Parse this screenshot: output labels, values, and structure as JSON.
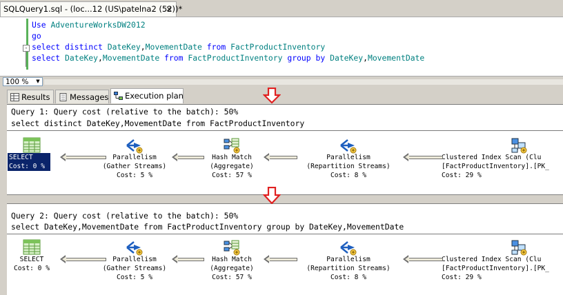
{
  "window": {
    "tab_title": "SQLQuery1.sql - (loc...12 (US\\patelna2 (52))*",
    "close_glyph": "×"
  },
  "editor": {
    "lines": [
      {
        "parts": [
          {
            "t": "Use ",
            "c": "kw"
          },
          {
            "t": "AdventureWorksDW2012",
            "c": "tx"
          }
        ]
      },
      {
        "parts": [
          {
            "t": "go",
            "c": "kw"
          }
        ]
      },
      {
        "parts": [
          {
            "t": "select distinct ",
            "c": "kw"
          },
          {
            "t": "DateKey",
            "c": "tx"
          },
          {
            "t": ",",
            "c": "pl"
          },
          {
            "t": "MovementDate ",
            "c": "tx"
          },
          {
            "t": "from ",
            "c": "kw"
          },
          {
            "t": "FactProductInventory",
            "c": "tx"
          }
        ]
      },
      {
        "parts": [
          {
            "t": "select ",
            "c": "kw"
          },
          {
            "t": "DateKey",
            "c": "tx"
          },
          {
            "t": ",",
            "c": "pl"
          },
          {
            "t": "MovementDate ",
            "c": "tx"
          },
          {
            "t": "from ",
            "c": "kw"
          },
          {
            "t": "FactProductInventory ",
            "c": "tx"
          },
          {
            "t": "group by ",
            "c": "kw"
          },
          {
            "t": "DateKey",
            "c": "tx"
          },
          {
            "t": ",",
            "c": "pl"
          },
          {
            "t": "MovementDate",
            "c": "tx"
          }
        ]
      }
    ],
    "outline_glyph": "-"
  },
  "zoom": {
    "value": "100 %",
    "dropdown_glyph": "▼"
  },
  "results_tabs": [
    {
      "label": "Results"
    },
    {
      "label": "Messages"
    },
    {
      "label": "Execution plan"
    }
  ],
  "queries": [
    {
      "header": "Query 1: Query cost (relative to the batch): 50%",
      "sql": "select distinct DateKey,MovementDate from FactProductInventory",
      "nodes": [
        {
          "name": "SELECT",
          "sub": "",
          "cost": "Cost: 0 %",
          "selected": true,
          "icon": "select-icon"
        },
        {
          "name": "Parallelism",
          "sub": "(Gather Streams)",
          "cost": "Cost: 5 %",
          "icon": "parallelism-icon"
        },
        {
          "name": "Hash Match",
          "sub": "(Aggregate)",
          "cost": "Cost: 57 %",
          "icon": "hash-match-icon"
        },
        {
          "name": "Parallelism",
          "sub": "(Repartition Streams)",
          "cost": "Cost: 8 %",
          "icon": "parallelism-icon"
        },
        {
          "name": "Clustered Index Scan (Clu",
          "sub": "[FactProductInventory].[PK_",
          "cost": "Cost: 29 %",
          "icon": "clustered-index-scan-icon"
        }
      ]
    },
    {
      "header": "Query 2: Query cost (relative to the batch): 50%",
      "sql": "select DateKey,MovementDate from FactProductInventory group by DateKey,MovementDate",
      "nodes": [
        {
          "name": "SELECT",
          "sub": "",
          "cost": "Cost: 0 %",
          "selected": false,
          "icon": "select-icon"
        },
        {
          "name": "Parallelism",
          "sub": "(Gather Streams)",
          "cost": "Cost: 5 %",
          "icon": "parallelism-icon"
        },
        {
          "name": "Hash Match",
          "sub": "(Aggregate)",
          "cost": "Cost: 57 %",
          "icon": "hash-match-icon"
        },
        {
          "name": "Parallelism",
          "sub": "(Repartition Streams)",
          "cost": "Cost: 8 %",
          "icon": "parallelism-icon"
        },
        {
          "name": "Clustered Index Scan (Clu",
          "sub": "[FactProductInventory].[PK_",
          "cost": "Cost: 29 %",
          "icon": "clustered-index-scan-icon"
        }
      ]
    }
  ],
  "colors": {
    "keyword": "#0000ff",
    "identifier": "#008080",
    "annotation_arrow": "#e02020",
    "selected_bg": "#0a246a"
  }
}
